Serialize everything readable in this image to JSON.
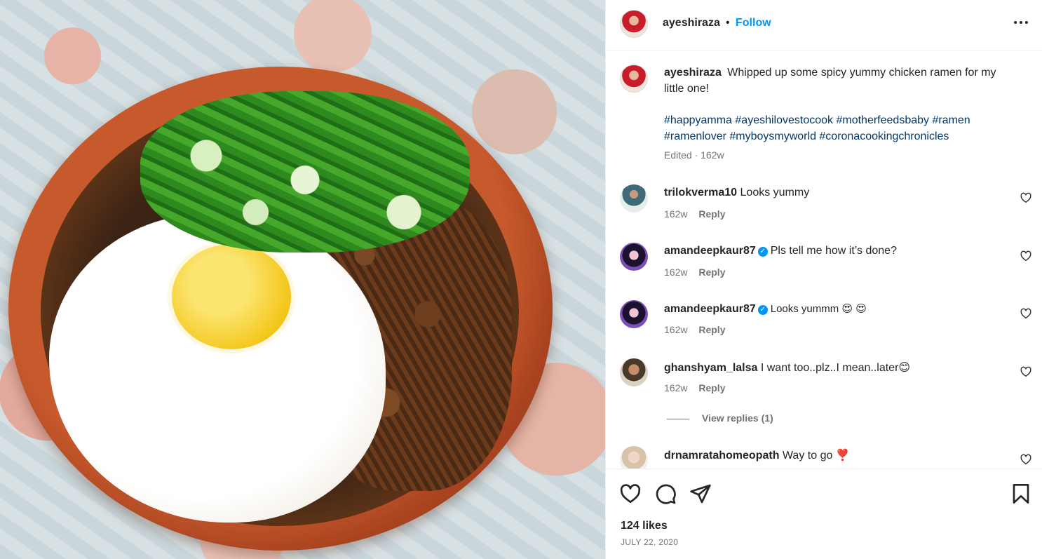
{
  "post": {
    "photo_alt": "Bowl of chicken ramen with fried egg and scallions"
  },
  "header": {
    "username": "ayeshiraza",
    "dot": "•",
    "follow_label": "Follow",
    "more_icon": "more-horizontal-icon"
  },
  "caption": {
    "username": "ayeshiraza",
    "text": "Whipped up some spicy yummy chicken ramen for my little one!",
    "hashtags": "#happyamma #ayeshilovestocook #motherfeedsbaby #ramen #ramenlover #myboysmyworld #coronacookingchronicles",
    "edited": "Edited · 162w"
  },
  "comments": [
    {
      "username": "trilokverma10",
      "verified": false,
      "text": "Looks yummy",
      "time": "162w",
      "reply": "Reply"
    },
    {
      "username": "amandeepkaur87",
      "verified": true,
      "text": "Pls tell me how it’s done?",
      "time": "162w",
      "reply": "Reply"
    },
    {
      "username": "amandeepkaur87",
      "verified": true,
      "text": "Looks yummm 😍 😍",
      "time": "162w",
      "reply": "Reply"
    },
    {
      "username": "ghanshyam_lalsa",
      "verified": false,
      "text": "I want too..plz..I mean..later😊",
      "time": "162w",
      "reply": "Reply"
    },
    {
      "username": "drnamratahomeopath",
      "verified": false,
      "text": "Way to go ❣️",
      "time": "",
      "reply": ""
    }
  ],
  "view_replies": "View replies (1)",
  "actions": {
    "like_icon": "heart-icon",
    "comment_icon": "comment-icon",
    "share_icon": "send-icon",
    "save_icon": "bookmark-icon"
  },
  "likes": "124 likes",
  "date": "JULY 22, 2020",
  "colors": {
    "link_blue": "#0095f6",
    "hashtag": "#00376b",
    "muted": "#737373",
    "text": "#262626"
  }
}
